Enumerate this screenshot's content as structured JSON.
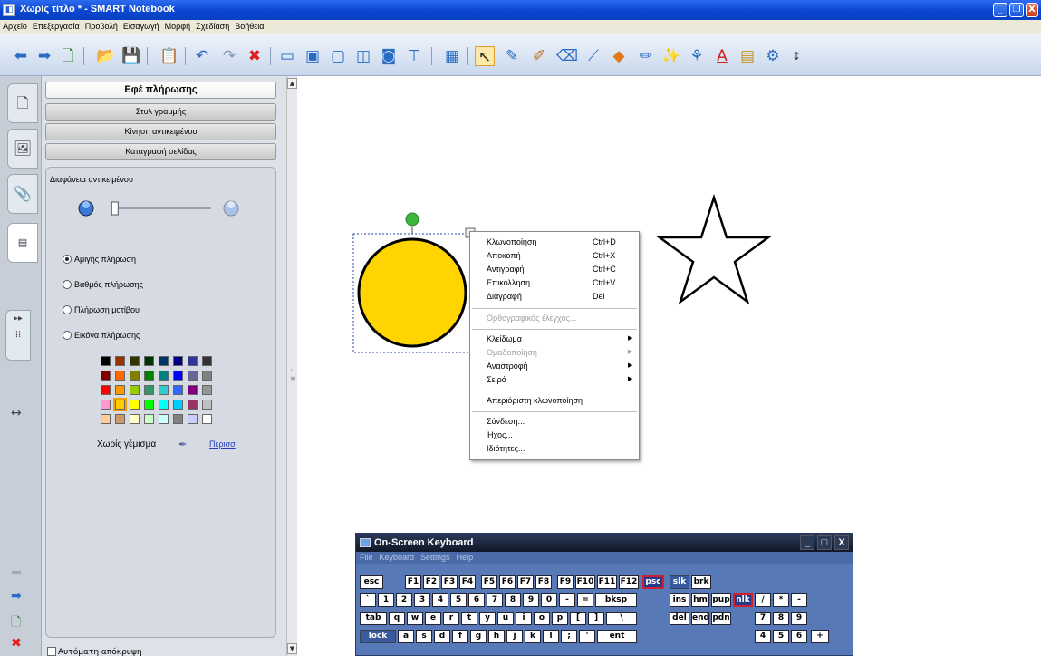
{
  "window": {
    "title": "Χωρίς τίτλο * - SMART Notebook",
    "btn_min": "_",
    "btn_max": "❐",
    "btn_close": "X"
  },
  "menu": [
    "Αρχείο",
    "Επεξεργασία",
    "Προβολή",
    "Εισαγωγή",
    "Μορφή",
    "Σχεδίαση",
    "Βοήθεια"
  ],
  "panel": {
    "sections": [
      "Εφέ πλήρωσης",
      "Στυλ γραμμής",
      "Κίνηση αντικειμένου",
      "Καταγραφή σελίδας"
    ],
    "transparency_label": "Διαφάνεια αντικειμένου",
    "transparency_level": 0.03,
    "fill_options": [
      "Αμιγής πλήρωση",
      "Βαθμός πλήρωσης",
      "Πλήρωση μοτίβου",
      "Εικόνα πλήρωσης"
    ],
    "selected_fill": 0,
    "no_fill_label": "Χωρίς γέμισμα",
    "more_label": "Περισσ",
    "palette": [
      [
        "#000000",
        "#993300",
        "#333300",
        "#003300",
        "#003366",
        "#000080",
        "#333399",
        "#333333"
      ],
      [
        "#800000",
        "#ff6600",
        "#808000",
        "#008000",
        "#008080",
        "#0000ff",
        "#666699",
        "#808080"
      ],
      [
        "#ff0000",
        "#ff9900",
        "#99cc00",
        "#339966",
        "#33cccc",
        "#3366ff",
        "#800080",
        "#969696"
      ],
      [
        "#ff99cc",
        "#ffcc00",
        "#ffff00",
        "#00ff00",
        "#00ffff",
        "#00ccff",
        "#993366",
        "#c0c0c0"
      ],
      [
        "#ffcc99",
        "#cc9966",
        "#ffffcc",
        "#ccffcc",
        "#ccffff",
        "#808080",
        "#ccccff",
        "#ffffff"
      ]
    ],
    "selected_swatch": [
      3,
      1
    ],
    "autohide_label": "Αυτόματη απόκρυψη"
  },
  "canvas": {
    "circle_fill": "#ffd400",
    "handle_color": "#3db83d"
  },
  "context_menu": [
    {
      "label": "Κλωνοποίηση",
      "shortcut": "Ctrl+D"
    },
    {
      "label": "Αποκοπή",
      "shortcut": "Ctrl+X"
    },
    {
      "label": "Αντιγραφή",
      "shortcut": "Ctrl+C"
    },
    {
      "label": "Επικόλληση",
      "shortcut": "Ctrl+V"
    },
    {
      "label": "Διαγραφή",
      "shortcut": "Del"
    },
    {
      "label": "Ορθογραφικός έλεγχος...",
      "disabled": true
    },
    {
      "label": "Κλείδωμα",
      "submenu": true
    },
    {
      "label": "Ομαδοποίηση",
      "submenu": true,
      "disabled": true
    },
    {
      "label": "Αναστροφή",
      "submenu": true
    },
    {
      "label": "Σειρά",
      "submenu": true
    },
    {
      "label": "Απεριόριστη κλωνοποίηση"
    },
    {
      "label": "Σύνδεση..."
    },
    {
      "label": "Ήχος..."
    },
    {
      "label": "Ιδιότητες..."
    }
  ],
  "keyboard": {
    "title": "On-Screen Keyboard",
    "menu": [
      "File",
      "Keyboard",
      "Settings",
      "Help"
    ],
    "win_min": "_",
    "win_max": "□",
    "win_close": "X",
    "rows": [
      [
        "esc",
        "F1",
        "F2",
        "F3",
        "F4",
        "F5",
        "F6",
        "F7",
        "F8",
        "F9",
        "F10",
        "F11",
        "F12",
        "psc",
        "slk",
        "brk"
      ],
      [
        "`",
        "1",
        "2",
        "3",
        "4",
        "5",
        "6",
        "7",
        "8",
        "9",
        "0",
        "-",
        "=",
        "bksp",
        "ins",
        "hm",
        "pup",
        "nlk",
        "/",
        "*",
        "-"
      ],
      [
        "tab",
        "q",
        "w",
        "e",
        "r",
        "t",
        "y",
        "u",
        "i",
        "o",
        "p",
        "[",
        "]",
        "\\",
        "del",
        "end",
        "pdn",
        "7",
        "8",
        "9"
      ],
      [
        "lock",
        "a",
        "s",
        "d",
        "f",
        "g",
        "h",
        "j",
        "k",
        "l",
        ";",
        "'",
        "ent",
        "4",
        "5",
        "6",
        "+"
      ]
    ]
  }
}
